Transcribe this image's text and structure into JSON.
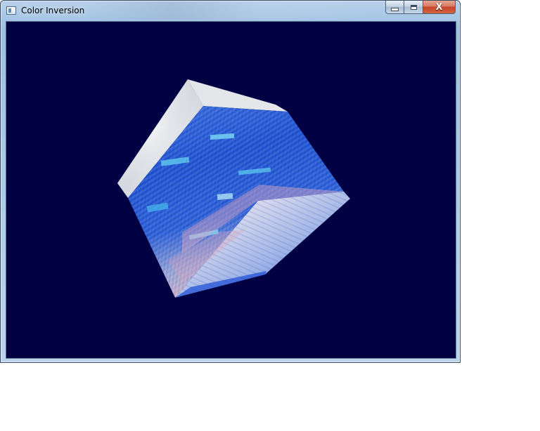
{
  "window": {
    "title": "Color Inversion"
  },
  "caption_buttons": {
    "minimize_icon": "minimize-icon",
    "maximize_icon": "maximize-icon",
    "close_glyph": "X"
  },
  "viewport": {
    "background_color": "#000042",
    "object": "cube",
    "colors": {
      "top_face": "#e8ebef",
      "left_face": "#2a5bd0",
      "right_face": "#c9c0d8",
      "accent_blue": "#1a4bd6",
      "accent_cyan": "#63d1f0",
      "accent_pink": "#e0a8c0"
    }
  }
}
